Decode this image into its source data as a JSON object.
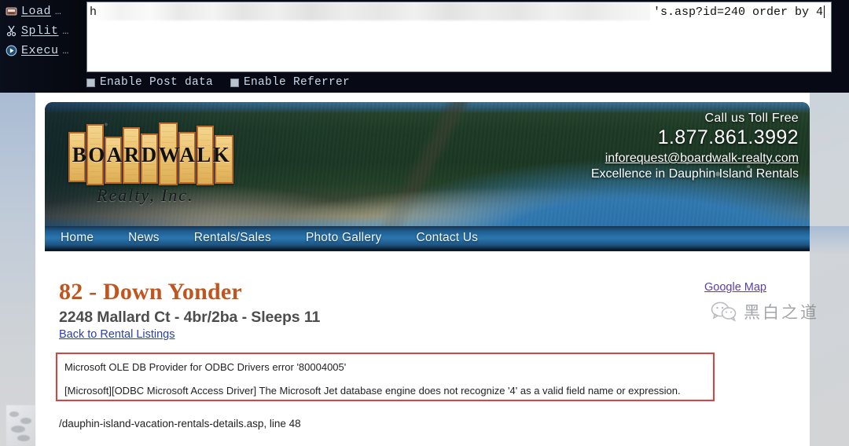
{
  "tool": {
    "buttons": [
      {
        "label": "Load",
        "dots": "…",
        "icon": "disk-icon"
      },
      {
        "label": "Split",
        "dots": "…",
        "icon": "scissors-icon"
      },
      {
        "label": "Execu",
        "dots": "…",
        "icon": "play-icon"
      }
    ],
    "url_input": {
      "head": "h",
      "redacted": true,
      "tail": "'s.asp?id=240 order by 4",
      "placeholder": "URL"
    },
    "checkboxes": [
      {
        "label": "Enable Post data",
        "checked": false
      },
      {
        "label": "Enable Referrer",
        "checked": false
      }
    ]
  },
  "site": {
    "logo": {
      "word": "BOARDWALK",
      "letters": [
        "B",
        "O",
        "A",
        "R",
        "D",
        "W",
        "A",
        "L",
        "K"
      ],
      "subtitle": "Realty, Inc."
    },
    "contact": {
      "toll_free": "Call us Toll Free",
      "phone": "1.877.861.3992",
      "email": "inforequest@boardwalk-realty.com",
      "tagline": "Excellence in Dauphin Island Rentals"
    },
    "nav": [
      {
        "label": "Home"
      },
      {
        "label": "News"
      },
      {
        "label": "Rentals/Sales"
      },
      {
        "label": "Photo Gallery"
      },
      {
        "label": "Contact Us"
      }
    ]
  },
  "listing": {
    "title": "82 - Down Yonder",
    "subtitle": "2248 Mallard Ct - 4br/2ba - Sleeps 11",
    "back_link": "Back to Rental Listings",
    "map_link": "Google Map"
  },
  "error": {
    "line1": "Microsoft OLE DB Provider for ODBC Drivers  error '80004005'",
    "line2": "[Microsoft][ODBC Microsoft Access Driver] The Microsoft Jet database engine does not recognize '4' as a valid field name or expression.",
    "path": "/dauphin-island-vacation-rentals-details.asp, line 48",
    "border_color": "#e0413f"
  },
  "watermark": {
    "text": "黑白之道",
    "icon": "wechat-icon"
  },
  "colors": {
    "title_orange": "#c0561f",
    "nav_blue": "#2a77b0",
    "link_blue": "#2b3fa8",
    "link_purple": "#5b3fa8",
    "tool_bg": "#070a14"
  }
}
